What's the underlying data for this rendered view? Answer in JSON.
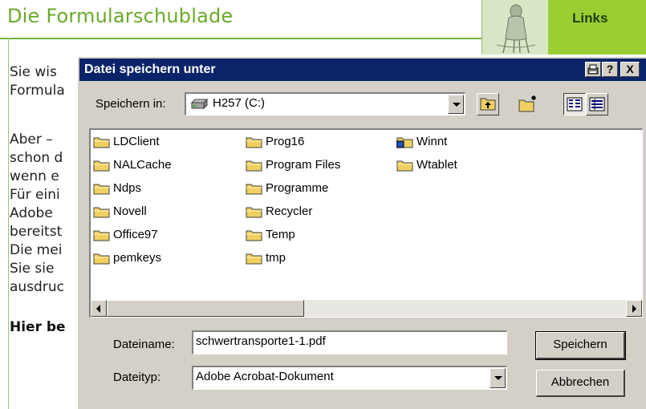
{
  "page": {
    "title": "Die Formularschublade",
    "links_label": "Links",
    "lines": [
      "Sie wis",
      "Formula",
      "Aber –",
      "schon d",
      "wenn e",
      "Für eini",
      "Adobe",
      "bereitst",
      "Die mei",
      "Sie sie",
      "ausdruc"
    ],
    "bold_line": "Hier be"
  },
  "dialog": {
    "title": "Datei speichern unter",
    "titlebar_buttons": [
      "?",
      "X"
    ],
    "save_in_label": "Speichern in:",
    "save_in_value": "H257 (C:)",
    "folders": [
      [
        "LDClient",
        "NALCache",
        "Ndps",
        "Novell",
        "Office97",
        "pemkeys"
      ],
      [
        "Prog16",
        "Program Files",
        "Programme",
        "Recycler",
        "Temp",
        "tmp"
      ],
      [
        "Winnt",
        "Wtablet"
      ]
    ],
    "filename_label": "Dateiname:",
    "filename_value": "schwertransporte1-1.pdf",
    "filetype_label": "Dateityp:",
    "filetype_value": "Adobe Acrobat-Dokument",
    "save_button": "Speichern",
    "cancel_button": "Abbrechen"
  },
  "icons": {
    "folder": "folder-icon",
    "drive": "hard-drive-icon",
    "up": "up-one-level-icon",
    "new_folder": "new-folder-icon",
    "list": "list-view-icon",
    "details": "details-view-icon",
    "settings": "settings-icon"
  },
  "colors": {
    "titlebar": "#0a246a",
    "page_title": "#6aaa2a",
    "links_bg": "#9acd32",
    "dialog_bg": "#d4d0c8",
    "folder": "#f0d060"
  }
}
